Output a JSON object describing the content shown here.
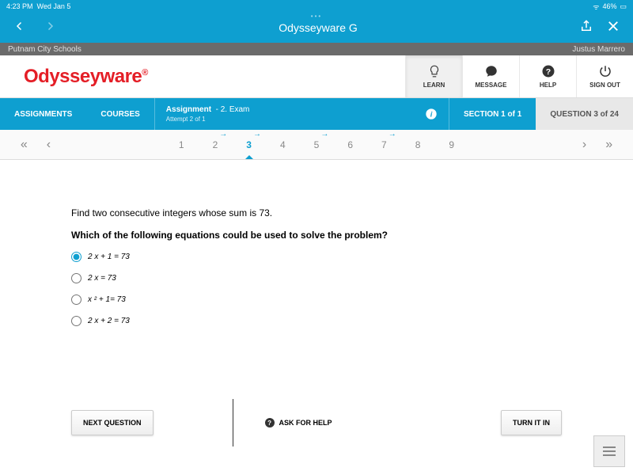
{
  "status_bar": {
    "time": "4:23 PM",
    "date": "Wed Jan 5",
    "battery": "46%"
  },
  "browser": {
    "title": "Odysseyware G"
  },
  "school_bar": {
    "district": "Putnam City Schools",
    "user": "Justus Marrero"
  },
  "brand": {
    "name": "Odysseyware",
    "reg": "®"
  },
  "header_actions": {
    "learn": "LEARN",
    "message": "MESSAGE",
    "help": "HELP",
    "signout": "SIGN OUT"
  },
  "nav": {
    "assignments": "ASSIGNMENTS",
    "courses": "COURSES",
    "assignment_label": "Assignment",
    "assignment_name": "- 2. Exam",
    "attempt": "Attempt 2 of 1",
    "section": "SECTION 1 of 1",
    "question": "QUESTION 3 of 24"
  },
  "pager": {
    "items": [
      "1",
      "2",
      "3",
      "4",
      "5",
      "6",
      "7",
      "8",
      "9"
    ],
    "active_index": 2,
    "marked": [
      1,
      2,
      4,
      6
    ]
  },
  "question": {
    "line1": "Find two consecutive integers whose sum is 73.",
    "line2": "Which of the following equations could be used to solve the problem?",
    "options": [
      {
        "text": "2 x + 1 = 73",
        "selected": true
      },
      {
        "text": "2 x = 73",
        "selected": false
      },
      {
        "text": "x ² + 1= 73",
        "selected": false
      },
      {
        "text": "2 x + 2 = 73",
        "selected": false
      }
    ]
  },
  "buttons": {
    "next": "NEXT QUESTION",
    "ask": "ASK FOR HELP",
    "turnin": "TURN IT IN"
  }
}
